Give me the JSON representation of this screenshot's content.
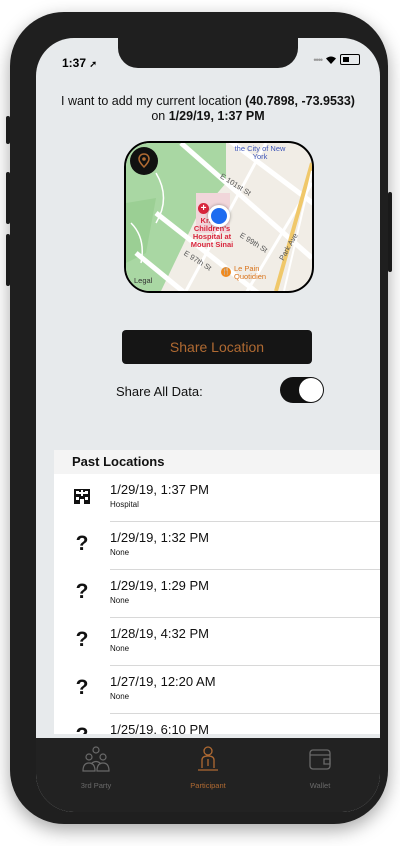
{
  "status": {
    "time": "1:37"
  },
  "heading": {
    "prefix": "I want to add my current location ",
    "coords": "(40.7898, -73.9533)",
    "mid": " on ",
    "datetime": "1/29/19, 1:37 PM"
  },
  "map": {
    "labels": {
      "city": "the City of New York",
      "street_101": "E 101st St",
      "hospital": "Kravis Children's Hospital at Mount Sinai",
      "street_99": "E 99th St",
      "park_ave": "Park Ave",
      "street_97": "E 97th St",
      "restaurant": "Le Pain Quotidien",
      "legal": "Legal"
    }
  },
  "share_button": {
    "label": "Share Location"
  },
  "share_all": {
    "label": "Share All Data:",
    "on": true
  },
  "past_locations": {
    "title": "Past Locations",
    "items": [
      {
        "date": "1/29/19, 1:37 PM",
        "place": "Hospital",
        "icon": "hospital-icon"
      },
      {
        "date": "1/29/19, 1:32 PM",
        "place": "None",
        "icon": "question-icon"
      },
      {
        "date": "1/29/19, 1:29 PM",
        "place": "None",
        "icon": "question-icon"
      },
      {
        "date": "1/28/19, 4:32 PM",
        "place": "None",
        "icon": "question-icon"
      },
      {
        "date": "1/27/19, 12:20 AM",
        "place": "None",
        "icon": "question-icon"
      },
      {
        "date": "1/25/19, 6:10 PM",
        "place": "",
        "icon": "question-icon"
      }
    ]
  },
  "tabs": [
    {
      "label": "3rd Party",
      "icon": "people-icon",
      "active": false
    },
    {
      "label": "Participant",
      "icon": "person-icon",
      "active": true
    },
    {
      "label": "Wallet",
      "icon": "wallet-icon",
      "active": false
    }
  ],
  "colors": {
    "accent": "#b06a32",
    "tab_inactive": "#6a6a6a",
    "screen_bg": "#e7eaec",
    "location_dot": "#1e6cf0"
  }
}
